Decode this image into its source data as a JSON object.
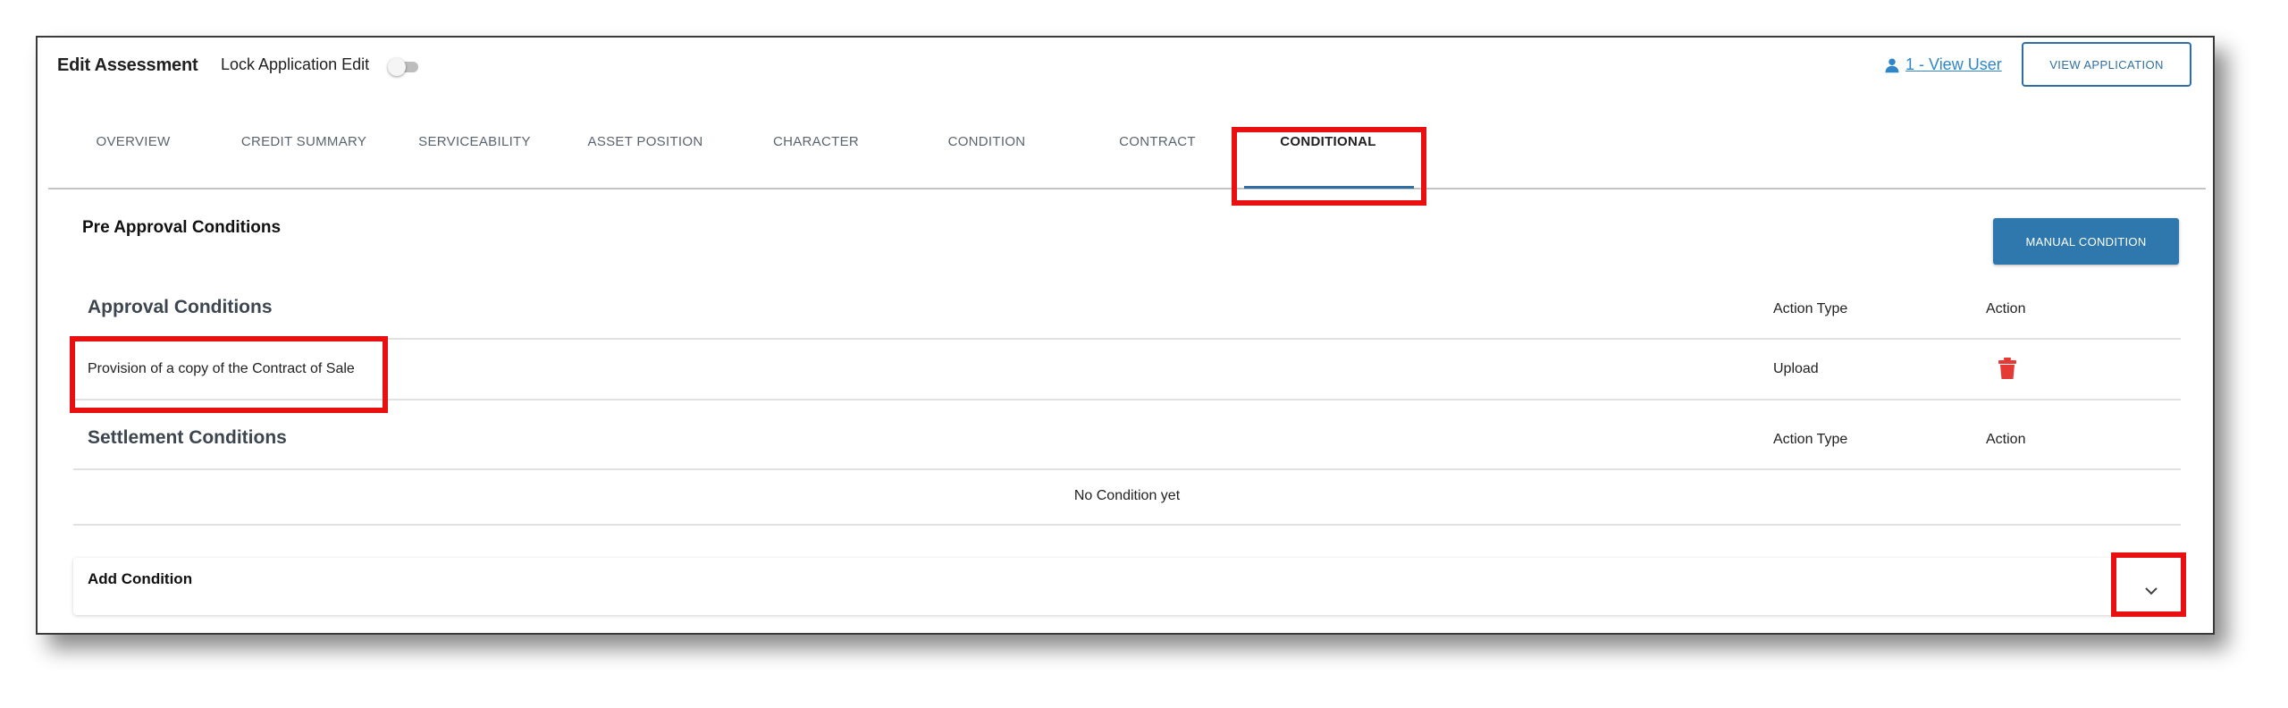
{
  "header": {
    "title": "Edit Assessment",
    "lock_label": "Lock Application Edit",
    "lock_toggle_on": false,
    "view_user_label": "1 - View User",
    "view_application_label": "VIEW APPLICATION"
  },
  "tabs": [
    {
      "label": "OVERVIEW",
      "active": false
    },
    {
      "label": "CREDIT SUMMARY",
      "active": false
    },
    {
      "label": "SERVICEABILITY",
      "active": false
    },
    {
      "label": "ASSET POSITION",
      "active": false
    },
    {
      "label": "CHARACTER",
      "active": false
    },
    {
      "label": "CONDITION",
      "active": false
    },
    {
      "label": "CONTRACT",
      "active": false
    },
    {
      "label": "CONDITIONAL",
      "active": true
    }
  ],
  "main": {
    "section_title": "Pre Approval Conditions",
    "manual_condition_label": "MANUAL CONDITION",
    "approval": {
      "title": "Approval Conditions",
      "col_action_type": "Action Type",
      "col_action": "Action",
      "rows": [
        {
          "condition": "Provision of a copy of the Contract of Sale",
          "action_type": "Upload",
          "action_icon": "trash-icon"
        }
      ]
    },
    "settlement": {
      "title": "Settlement Conditions",
      "col_action_type": "Action Type",
      "col_action": "Action",
      "empty_text": "No Condition yet"
    },
    "add_condition_label": "Add Condition"
  },
  "colors": {
    "accent": "#2f78ad",
    "link": "#2f86c8",
    "delete": "#e53935",
    "callout": "#e81010"
  }
}
